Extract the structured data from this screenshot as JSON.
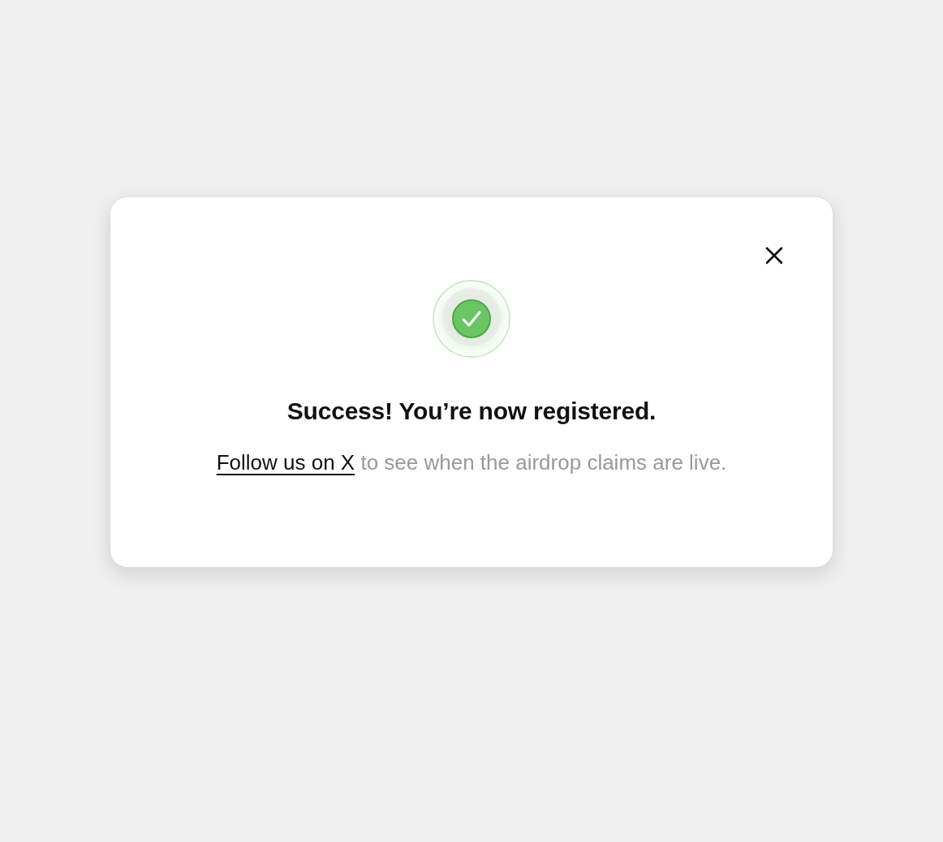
{
  "dialog": {
    "title": "Success! You’re now registered.",
    "message": {
      "link": "Follow us on X",
      "text": "to see when the airdrop claims are live."
    }
  }
}
